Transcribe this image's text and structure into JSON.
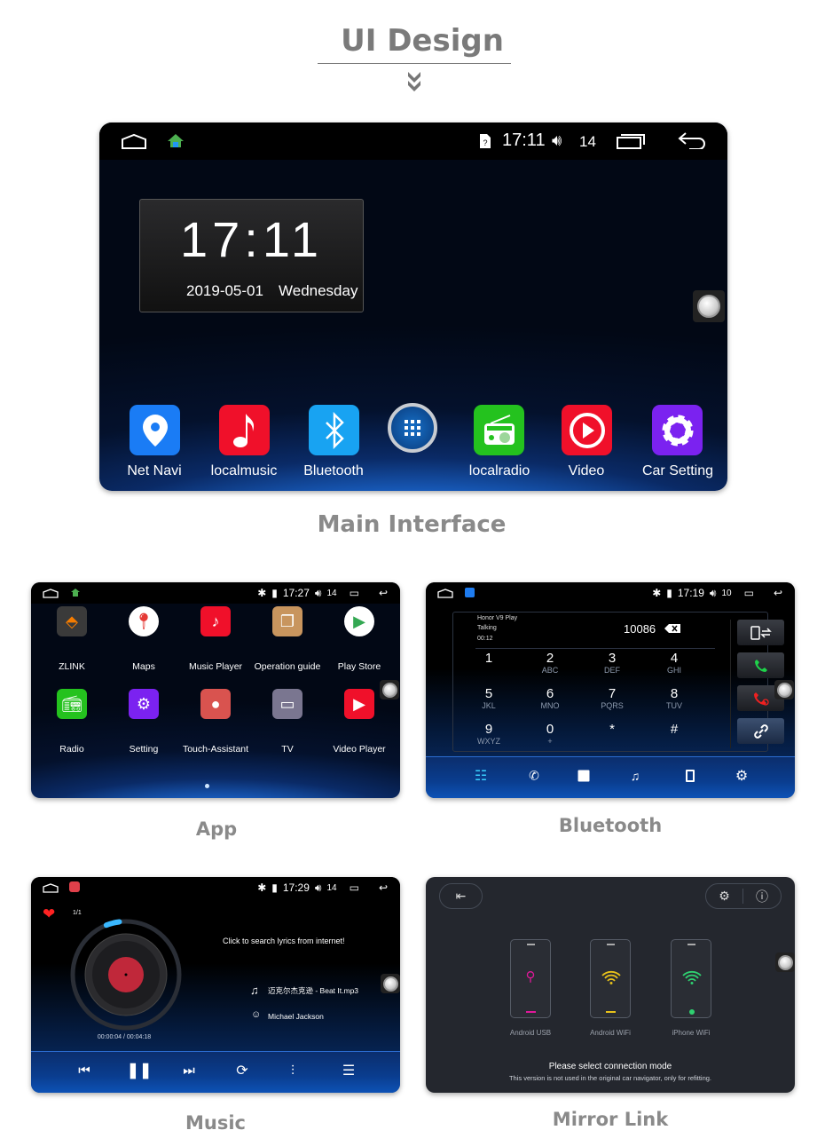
{
  "header": {
    "title": "UI Design"
  },
  "main_interface": {
    "caption": "Main Interface",
    "status": {
      "time": "17:11",
      "volume": "14"
    },
    "clock": {
      "time": "17:11",
      "date": "2019-05-01",
      "weekday": "Wednesday"
    },
    "dock": [
      {
        "label": "Net Navi",
        "color": "#1a7cf5",
        "icon": "map-pin-icon"
      },
      {
        "label": "localmusic",
        "color": "#f0102a",
        "icon": "music-note-icon"
      },
      {
        "label": "Bluetooth",
        "color": "#18a3f2",
        "icon": "bluetooth-icon"
      },
      {
        "label": "",
        "color": "#0c57a8",
        "icon": "apps-grid-icon"
      },
      {
        "label": "localradio",
        "color": "#24c21e",
        "icon": "radio-icon"
      },
      {
        "label": "Video",
        "color": "#f0102a",
        "icon": "play-icon"
      },
      {
        "label": "Car Setting",
        "color": "#7b22f0",
        "icon": "gear-icon"
      }
    ]
  },
  "app_screen": {
    "caption": "App",
    "status": {
      "time": "17:27",
      "volume": "14"
    },
    "apps": [
      {
        "label": "ZLINK",
        "color": "#3a3a3a",
        "icon": "zlink-icon"
      },
      {
        "label": "Maps",
        "color": "#ffffff",
        "icon": "maps-icon"
      },
      {
        "label": "Music Player",
        "color": "#f0102a",
        "icon": "music-note-icon"
      },
      {
        "label": "Operation guide",
        "color": "#c8955e",
        "icon": "book-icon"
      },
      {
        "label": "Play Store",
        "color": "#ffffff",
        "icon": "play-store-icon"
      },
      {
        "label": "Radio",
        "color": "#24c21e",
        "icon": "radio-icon"
      },
      {
        "label": "Setting",
        "color": "#7b22f0",
        "icon": "gear-icon"
      },
      {
        "label": "Touch-Assistant",
        "color": "#d9534f",
        "icon": "touch-assistant-icon"
      },
      {
        "label": "TV",
        "color": "#7a7690",
        "icon": "tv-icon"
      },
      {
        "label": "Video Player",
        "color": "#f0102a",
        "icon": "play-icon"
      }
    ]
  },
  "bluetooth_screen": {
    "caption": "Bluetooth",
    "status": {
      "time": "17:19",
      "volume": "10"
    },
    "call": {
      "device": "Honor V9 Play",
      "state": "Talking",
      "duration": "00:12",
      "number": "10086"
    },
    "keys": [
      {
        "d": "1",
        "l": ""
      },
      {
        "d": "2",
        "l": "ABC"
      },
      {
        "d": "3",
        "l": "DEF"
      },
      {
        "d": "4",
        "l": "GHI"
      },
      {
        "d": "5",
        "l": "JKL"
      },
      {
        "d": "6",
        "l": "MNO"
      },
      {
        "d": "7",
        "l": "PQRS"
      },
      {
        "d": "8",
        "l": "TUV"
      },
      {
        "d": "9",
        "l": "WXYZ"
      },
      {
        "d": "0",
        "l": "+"
      },
      {
        "d": "*",
        "l": ""
      },
      {
        "d": "#",
        "l": ""
      }
    ],
    "side_buttons": [
      "transfer-audio-icon",
      "answer-call-icon",
      "hang-up-icon",
      "link-icon"
    ],
    "tabs": [
      "dialpad-icon",
      "call-log-icon",
      "contacts-icon",
      "bt-music-icon",
      "phone-device-icon",
      "bt-settings-icon"
    ]
  },
  "music_screen": {
    "caption": "Music",
    "status": {
      "time": "17:29",
      "volume": "14"
    },
    "track_index": "1/1",
    "lyrics_hint": "Click to search lyrics from internet!",
    "song": "迈克尔杰克逊 - Beat It.mp3",
    "artist": "Michael Jackson",
    "time": "00:00:04 / 00:04:18",
    "progress": 0.015,
    "controls": [
      "previous-icon",
      "pause-icon",
      "next-icon",
      "repeat-icon",
      "equalizer-icon",
      "playlist-icon"
    ]
  },
  "mirror_screen": {
    "caption": "Mirror Link",
    "modes": [
      {
        "label": "Android USB",
        "color": "#e0189a"
      },
      {
        "label": "Android WiFi",
        "color": "#e8c21a"
      },
      {
        "label": "iPhone WiFi",
        "color": "#2fd070"
      }
    ],
    "prompt": "Please select connection mode",
    "note": "This version is not used in the original car navigator, only for refitting."
  }
}
